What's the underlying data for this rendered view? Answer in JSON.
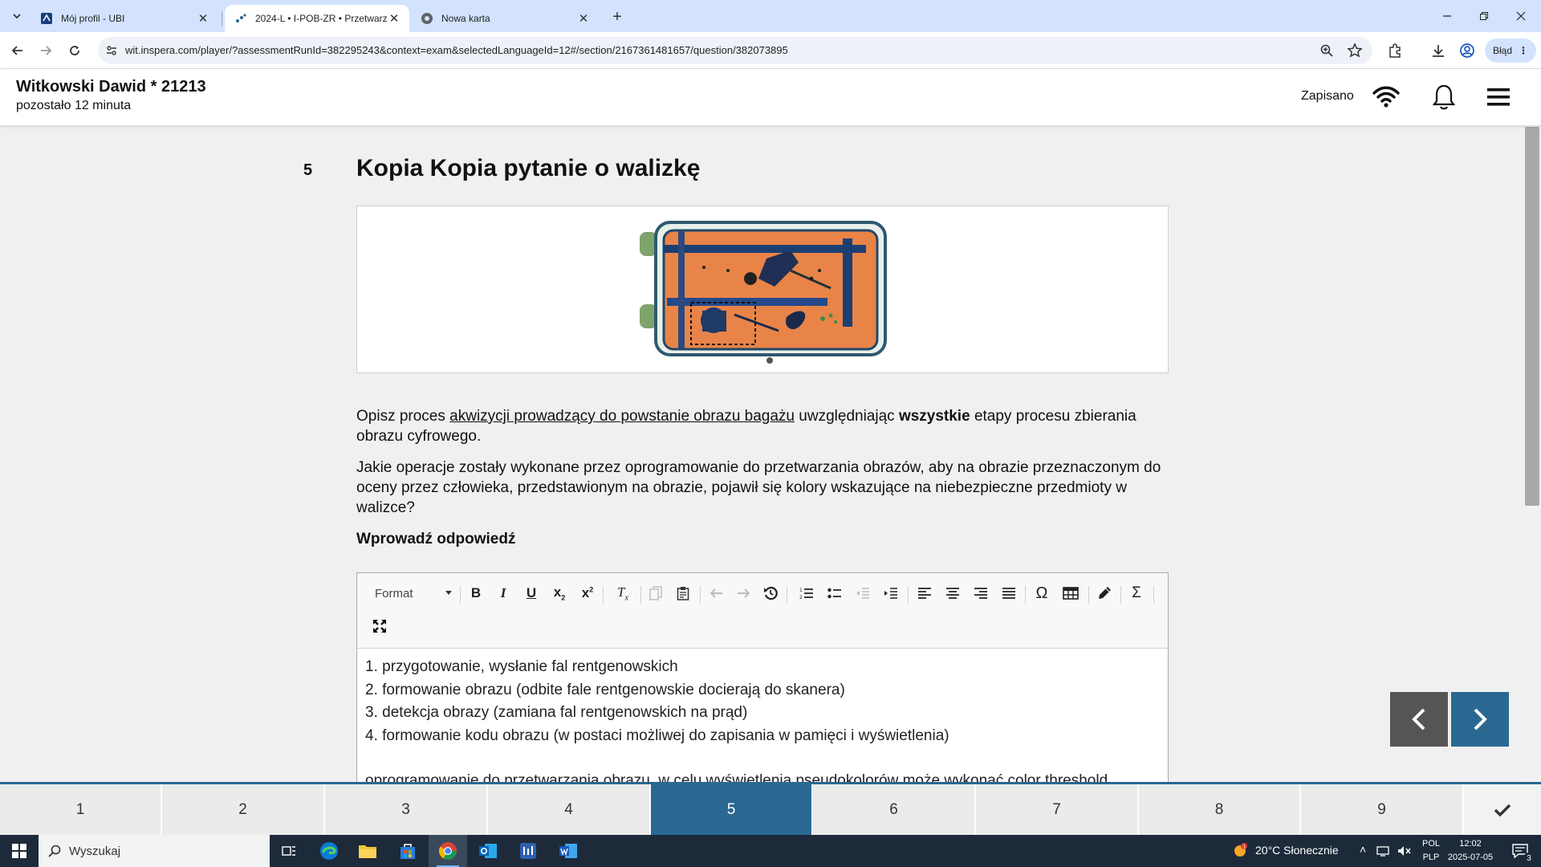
{
  "browser": {
    "tabs": [
      {
        "title": "Mój profil - UBI"
      },
      {
        "title": "2024-L • I-POB-ZR • Przetwarza"
      },
      {
        "title": "Nowa karta"
      }
    ],
    "url": "wit.inspera.com/player/?assessmentRunId=382295243&context=exam&selectedLanguageId=12#/section/2167361481657/question/382073895",
    "error_label": "Błąd"
  },
  "header": {
    "candidate": "Witkowski Dawid * 21213",
    "time_left": "pozostało 12 minuta",
    "save_status": "Zapisano"
  },
  "question": {
    "number": "5",
    "title": "Kopia Kopia pytanie o walizkę",
    "p1_before": "Opisz proces ",
    "p1_link": "akwizycji prowadzący do powstanie obrazu bagażu",
    "p1_middle": " uwzględniając ",
    "p1_bold": "wszystkie",
    "p1_after": " etapy procesu zbierania obrazu cyfrowego.",
    "p2": "Jakie operacje zostały wykonane przez oprogramowanie do przetwarzania obrazów, aby na obrazie przeznaczonym do oceny przez człowieka, przedstawionym na obrazie, pojawił się kolory wskazujące na niebezpieczne przedmioty w walizce?",
    "answer_label": "Wprowadź odpowiedź"
  },
  "editor": {
    "format_label": "Format",
    "lines": [
      "1. przygotowanie, wysłanie fal rentgenowskich",
      "2. formowanie obrazu (odbite fale rentgenowskie docierają do skanera)",
      "3. detekcja obrazy (zamiana fal rentgenowskich na prąd)",
      "4. formowanie kodu obrazu (w postaci możliwej do zapisania w pamięci i wyświetlenia)"
    ],
    "partial_line": "oprogramowanie do przetwarzania obrazu, w celu wyświetlenia pseudokolorów może wykonać color threshold"
  },
  "question_nav": {
    "items": [
      "1",
      "2",
      "3",
      "4",
      "5",
      "6",
      "7",
      "8",
      "9"
    ],
    "active": "5"
  },
  "taskbar": {
    "search_label": "Wyszukaj",
    "weather": "20°C  Słonecznie",
    "lang_top": "POL",
    "lang_bottom": "PLP",
    "time": "12:02",
    "date": "2025-07-05",
    "notification_count": "3"
  },
  "colors": {
    "accent": "#2b6891",
    "nav_button": "#555555",
    "nav_button_next": "#2b6891",
    "tabstrip": "#d3e3fd"
  }
}
